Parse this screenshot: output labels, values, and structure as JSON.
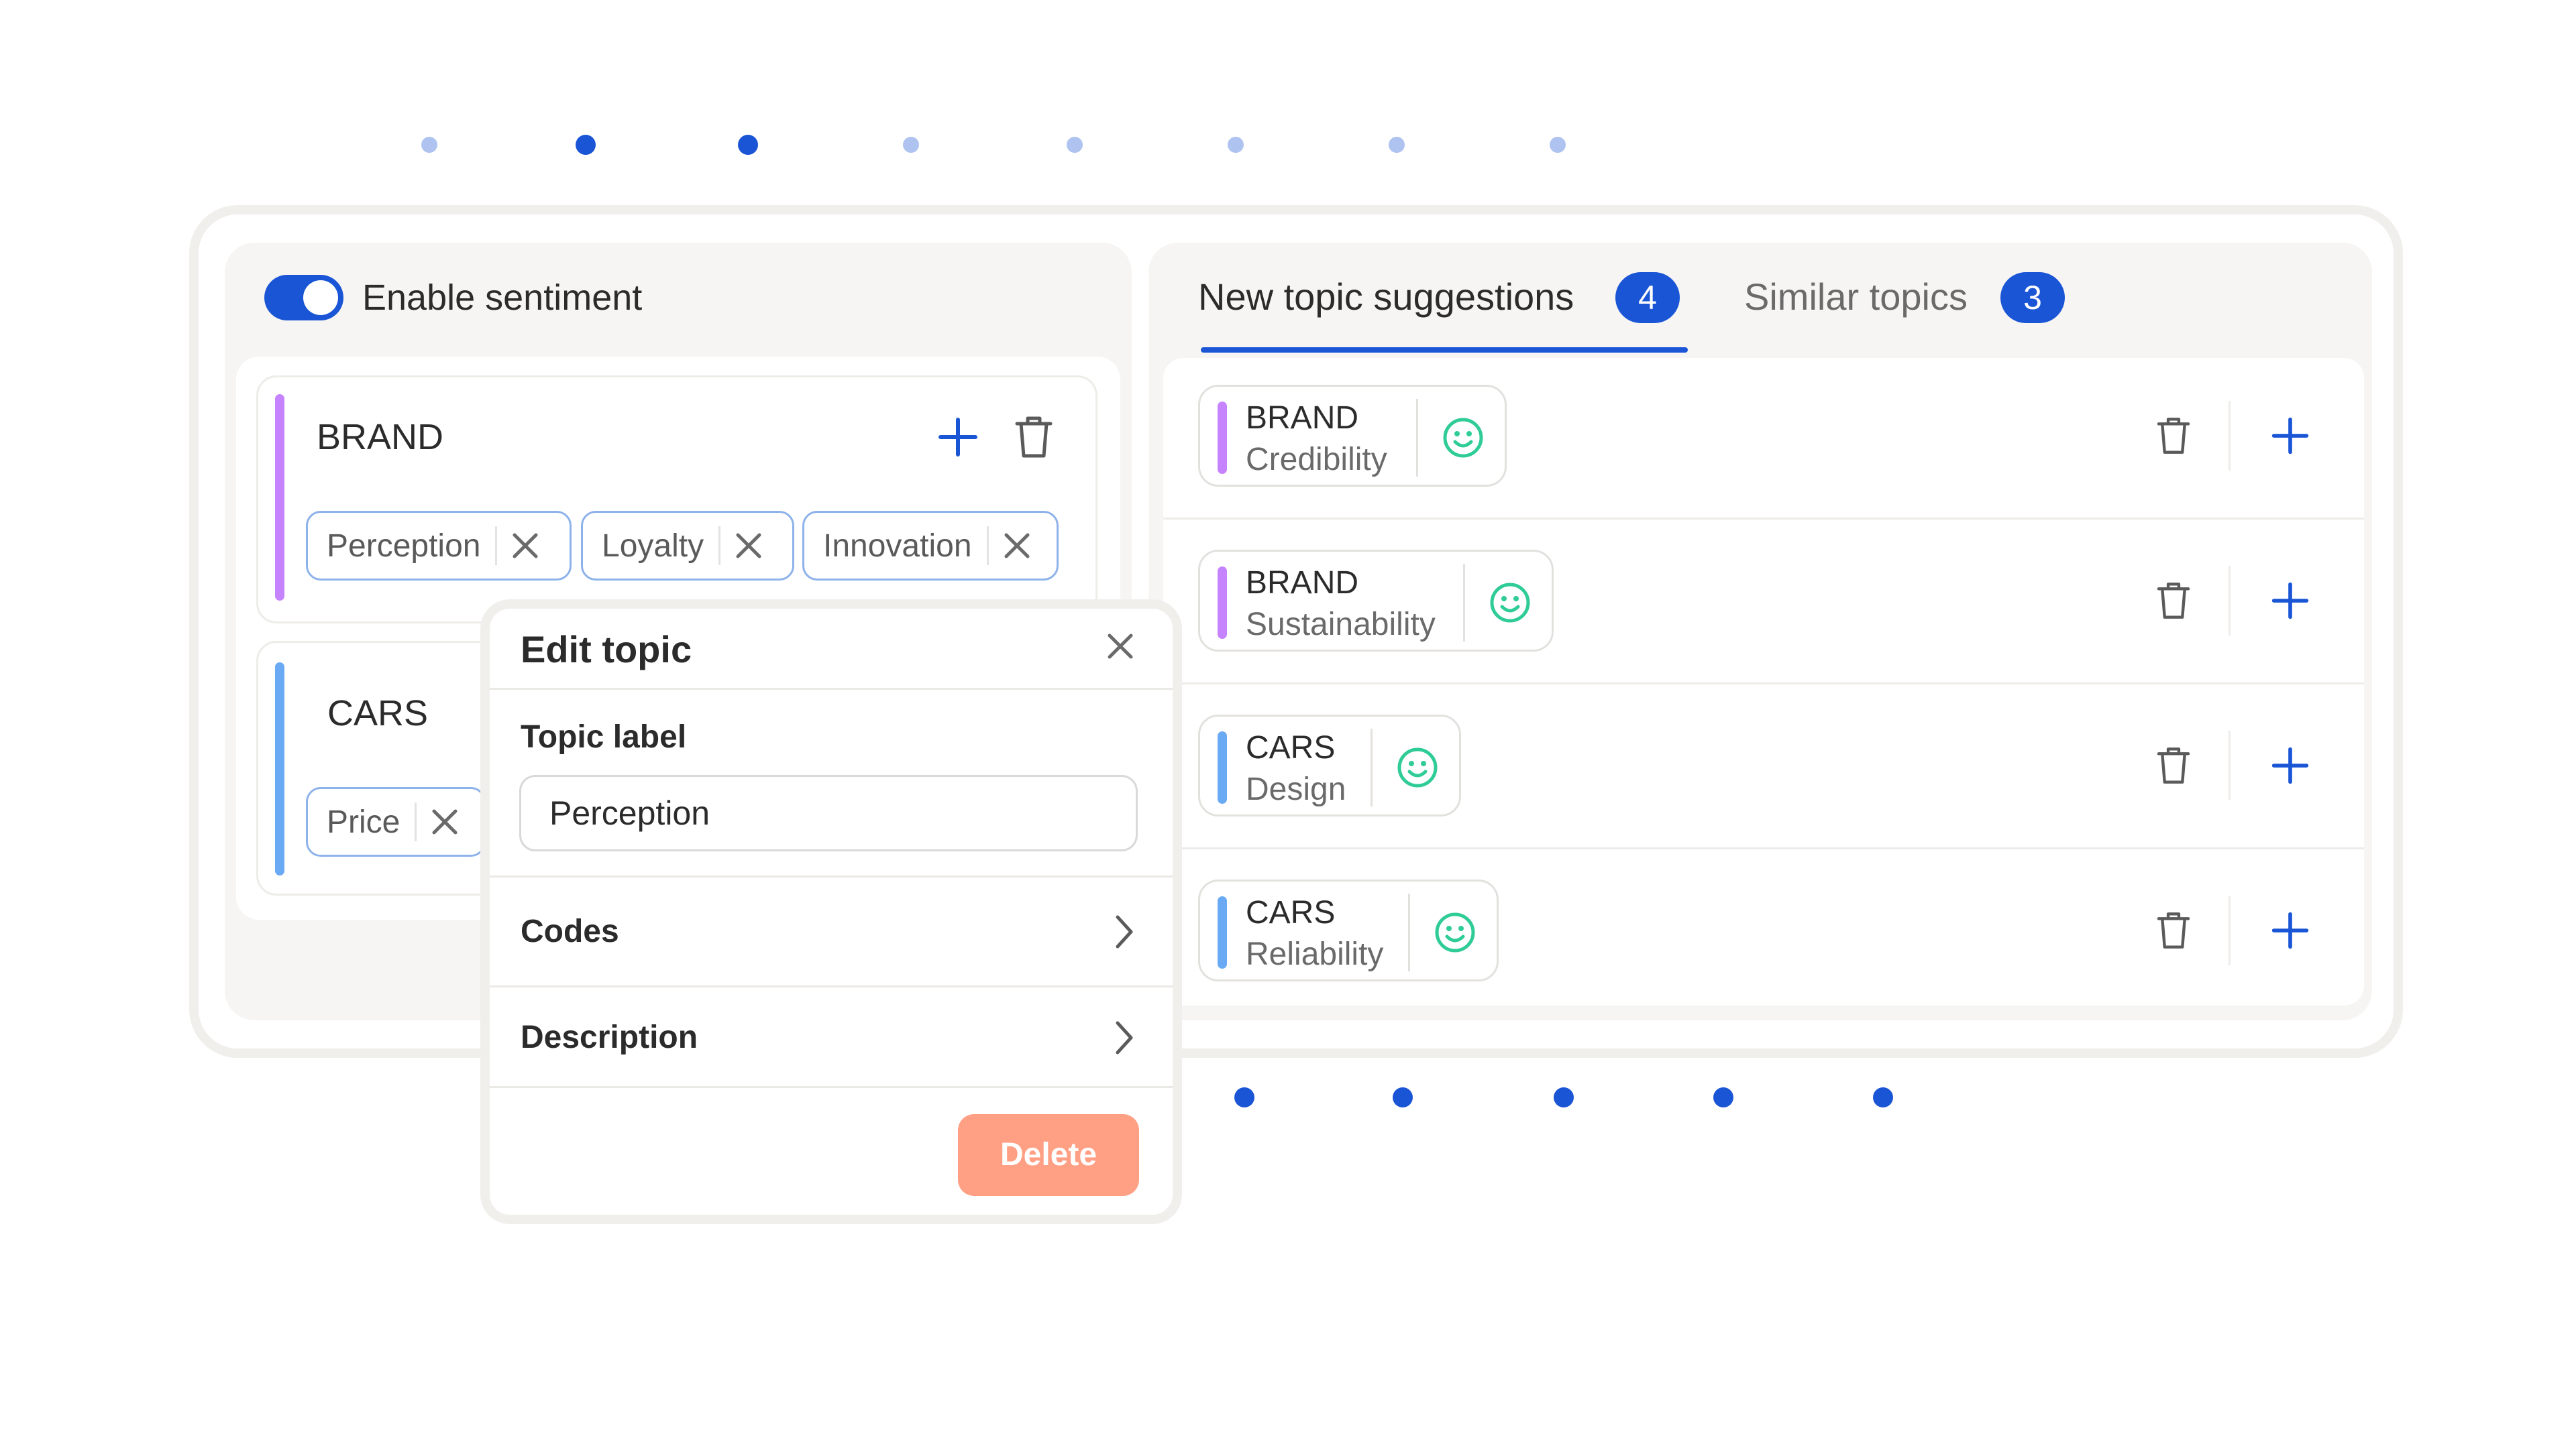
{
  "colors": {
    "accent": "#1a55d6",
    "brand_bar": "#c583ff",
    "cars_bar": "#6aaaf5",
    "delete": "#ff9f84",
    "smile": "#2fcc96"
  },
  "sentiment": {
    "label": "Enable sentiment",
    "enabled": true
  },
  "groups": [
    {
      "title": "BRAND",
      "chips": [
        "Perception",
        "Loyalty",
        "Innovation"
      ]
    },
    {
      "title": "CARS",
      "chips": [
        "Price"
      ]
    }
  ],
  "edit_topic": {
    "title": "Edit topic",
    "topic_label_title": "Topic label",
    "topic_label_value": "Perception",
    "codes_label": "Codes",
    "description_label": "Description",
    "delete_label": "Delete"
  },
  "tabs": [
    {
      "label": "New topic suggestions",
      "count": "4",
      "active": true
    },
    {
      "label": "Similar topics",
      "count": "3",
      "active": false
    }
  ],
  "suggestions": [
    {
      "category": "BRAND",
      "name": "Credibility",
      "icon": "smile-icon"
    },
    {
      "category": "BRAND",
      "name": "Sustainability",
      "icon": "smile-icon"
    },
    {
      "category": "CARS",
      "name": "Design",
      "icon": "smile-icon"
    },
    {
      "category": "CARS",
      "name": "Reliability",
      "icon": "smile-icon"
    }
  ]
}
